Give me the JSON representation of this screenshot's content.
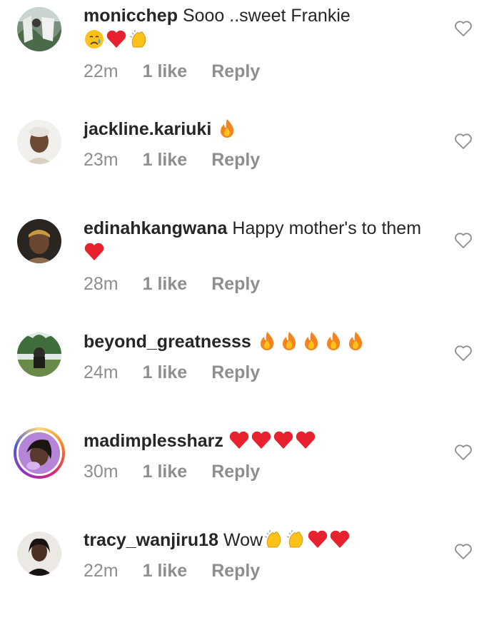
{
  "comments": [
    {
      "username": "monicchep",
      "text": "Sooo ..sweet Frankie",
      "emojis": [
        "sad-tear-emoji",
        "red-heart-emoji",
        "clapping-hands-emoji"
      ],
      "time": "22m",
      "likes": "1 like",
      "reply": "Reply"
    },
    {
      "username": "jackline.kariuki",
      "text": "",
      "emojis": [
        "fire-emoji"
      ],
      "time": "23m",
      "likes": "1 like",
      "reply": "Reply"
    },
    {
      "username": "edinahkangwana",
      "text": "Happy mother's to them",
      "emojis": [
        "red-heart-emoji"
      ],
      "time": "28m",
      "likes": "1 like",
      "reply": "Reply"
    },
    {
      "username": "beyond_greatnesss",
      "text": "",
      "emojis": [
        "fire-emoji",
        "fire-emoji",
        "fire-emoji",
        "fire-emoji",
        "fire-emoji"
      ],
      "time": "24m",
      "likes": "1 like",
      "reply": "Reply"
    },
    {
      "username": "madimplessharz",
      "text": "",
      "emojis": [
        "red-heart-emoji",
        "red-heart-emoji",
        "red-heart-emoji",
        "red-heart-emoji"
      ],
      "time": "30m",
      "likes": "1 like",
      "reply": "Reply"
    },
    {
      "username": "tracy_wanjiru18",
      "text": "Wow",
      "emojis": [
        "clapping-hands-emoji",
        "clapping-hands-emoji",
        "red-heart-emoji",
        "red-heart-emoji"
      ],
      "time": "22m",
      "likes": "1 like",
      "reply": "Reply"
    }
  ],
  "colors": {
    "text": "#262626",
    "meta": "#8e8e8e",
    "heart_emoji": "#e8212e",
    "fire_emoji": "#f5841f"
  }
}
